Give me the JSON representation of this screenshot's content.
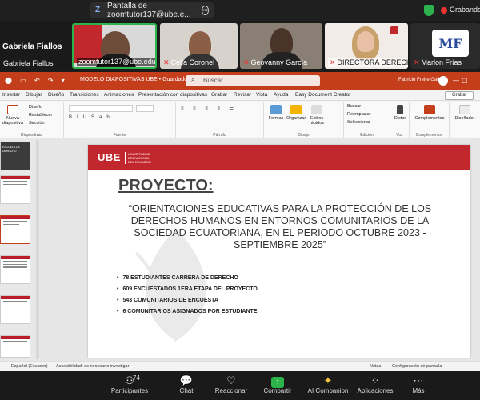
{
  "zoom": {
    "sharing_label": "Pantalla de zoomtutor137@ube.e...",
    "recording_label": "Grabando",
    "host_name_big": "Gabriela Fiallos",
    "participants": [
      {
        "name": "Gabriela Fiallos",
        "muted": false
      },
      {
        "name": "zoomtutor137@ube.edu...",
        "muted": false
      },
      {
        "name": "Celia Coronel",
        "muted": true
      },
      {
        "name": "Geovanny García",
        "muted": true
      },
      {
        "name": "DIRECTORA DERECH...",
        "muted": true
      },
      {
        "name": "Marlon Frías",
        "muted": true
      }
    ],
    "bottom": {
      "participants_label": "Participantes",
      "participants_count": "74",
      "chat_label": "Chat",
      "react_label": "Reaccionar",
      "share_label": "Compartir",
      "ai_label": "AI Companion",
      "apps_label": "Aplicaciones",
      "more_label": "Más"
    }
  },
  "office": {
    "doc_title": "MODELO DIAPOSITIVAS UBE • Guardado",
    "search_placeholder": "Buscar",
    "user_name": "Fabricio Freire Gaibor",
    "menu": [
      "Insertar",
      "Dibujar",
      "Diseño",
      "Transiciones",
      "Animaciones",
      "Presentación con diapositivas",
      "Grabar",
      "Revisar",
      "Vista",
      "Ayuda",
      "Easy Document Creator"
    ],
    "grabar_btn": "Grabar",
    "ribbon": {
      "nueva": "Nueva diapositiva",
      "diseno": "Diseño",
      "restablecer": "Restablecer",
      "seccion": "Sección",
      "grp_diapositivas": "Diapositivas",
      "grp_fuente": "Fuente",
      "grp_parrafo": "Párrafo",
      "formas": "Formas",
      "organizar": "Organizar",
      "estilos": "Estilos rápidos",
      "grp_dibujo": "Dibujo",
      "buscar": "Buscar",
      "reemplazar": "Reemplazar",
      "seleccionar": "Seleccionar",
      "grp_edicion": "Edición",
      "dictar": "Dictar",
      "grp_voz": "Voz",
      "complementos": "Complementos",
      "grp_complementos": "Complementos",
      "disenador": "Diseñador"
    },
    "status": {
      "language": "Español (Ecuador)",
      "accessibility": "Accesibilidad: es necesario investigar",
      "notes": "Notas",
      "display": "Configuración de pantalla"
    }
  },
  "slide": {
    "logo": "UBE",
    "logo_sub": [
      "UNIVERSIDAD",
      "BOLIVARIANA",
      "DEL ECUADOR"
    ],
    "title": "PROYECTO:",
    "description": "“ORIENTACIONES EDUCATIVAS PARA LA PROTECCIÓN DE LOS DERECHOS HUMANOS EN ENTORNOS COMUNITARIOS DE LA SOCIEDAD ECUATORIANA, EN EL PERIODO OCTUBRE 2023 - SEPTIEMBRE 2025”",
    "bullets": [
      "78 ESTUDIANTES CARRERA DE DERECHO",
      "609 ENCUESTADOS 1ERA ETAPA DEL PROYECTO",
      "543 COMUNITARIOS DE ENCUESTA",
      "6 COMUNITARIOS ASIGNADOS POR ESTUDIANTE"
    ]
  },
  "thumbs": {
    "first_title": "ESCUELA DE DERECHO"
  },
  "colors": {
    "office_accent": "#c43e1c",
    "ube_red": "#c1272d",
    "zoom_green": "#2cb34a",
    "muted_red": "#e53935"
  }
}
